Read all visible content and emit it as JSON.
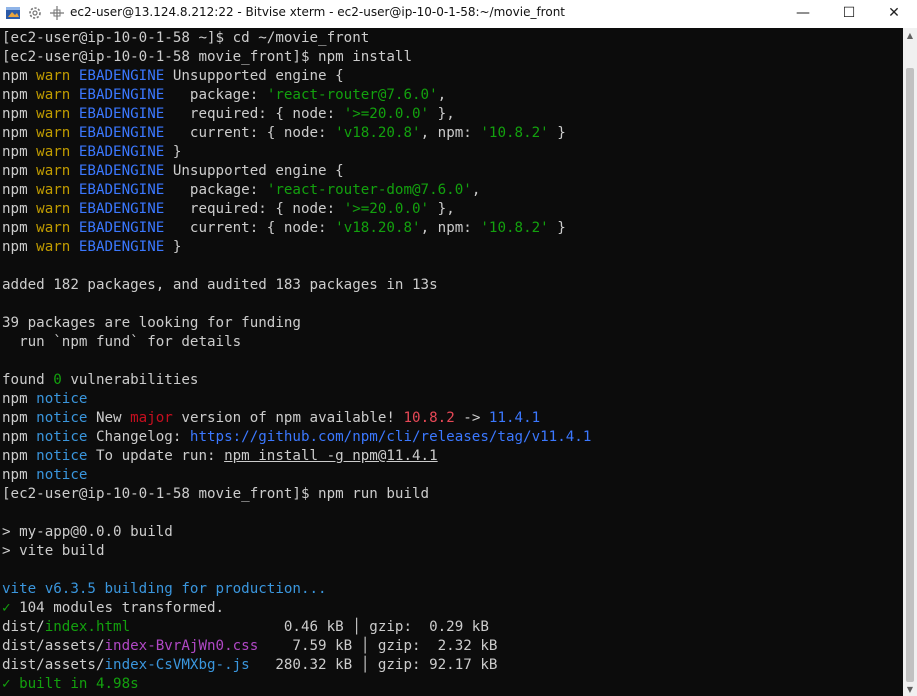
{
  "window": {
    "title": "ec2-user@13.124.8.212:22 - Bitvise xterm - ec2-user@ip-10-0-1-58:~/movie_front",
    "minimize_glyph": "—",
    "maximize_glyph": "☐",
    "close_glyph": "✕"
  },
  "terminal": {
    "lines": [
      [
        {
          "t": "[ec2-user@ip-10-0-1-58 ~]$ cd ~/movie_front",
          "c": "white"
        }
      ],
      [
        {
          "t": "[ec2-user@ip-10-0-1-58 movie_front]$ npm install",
          "c": "white"
        }
      ],
      [
        {
          "t": "npm ",
          "c": "white"
        },
        {
          "t": "warn",
          "c": "yellow"
        },
        {
          "t": " ",
          "c": "white"
        },
        {
          "t": "EBADENGINE",
          "c": "blue"
        },
        {
          "t": " Unsupported engine {",
          "c": "white"
        }
      ],
      [
        {
          "t": "npm ",
          "c": "white"
        },
        {
          "t": "warn",
          "c": "yellow"
        },
        {
          "t": " ",
          "c": "white"
        },
        {
          "t": "EBADENGINE",
          "c": "blue"
        },
        {
          "t": "   package: ",
          "c": "white"
        },
        {
          "t": "'react-router@7.6.0'",
          "c": "green"
        },
        {
          "t": ",",
          "c": "white"
        }
      ],
      [
        {
          "t": "npm ",
          "c": "white"
        },
        {
          "t": "warn",
          "c": "yellow"
        },
        {
          "t": " ",
          "c": "white"
        },
        {
          "t": "EBADENGINE",
          "c": "blue"
        },
        {
          "t": "   required: { node: ",
          "c": "white"
        },
        {
          "t": "'>=20.0.0'",
          "c": "green"
        },
        {
          "t": " },",
          "c": "white"
        }
      ],
      [
        {
          "t": "npm ",
          "c": "white"
        },
        {
          "t": "warn",
          "c": "yellow"
        },
        {
          "t": " ",
          "c": "white"
        },
        {
          "t": "EBADENGINE",
          "c": "blue"
        },
        {
          "t": "   current: { node: ",
          "c": "white"
        },
        {
          "t": "'v18.20.8'",
          "c": "green"
        },
        {
          "t": ", npm: ",
          "c": "white"
        },
        {
          "t": "'10.8.2'",
          "c": "green"
        },
        {
          "t": " }",
          "c": "white"
        }
      ],
      [
        {
          "t": "npm ",
          "c": "white"
        },
        {
          "t": "warn",
          "c": "yellow"
        },
        {
          "t": " ",
          "c": "white"
        },
        {
          "t": "EBADENGINE",
          "c": "blue"
        },
        {
          "t": " }",
          "c": "white"
        }
      ],
      [
        {
          "t": "npm ",
          "c": "white"
        },
        {
          "t": "warn",
          "c": "yellow"
        },
        {
          "t": " ",
          "c": "white"
        },
        {
          "t": "EBADENGINE",
          "c": "blue"
        },
        {
          "t": " Unsupported engine {",
          "c": "white"
        }
      ],
      [
        {
          "t": "npm ",
          "c": "white"
        },
        {
          "t": "warn",
          "c": "yellow"
        },
        {
          "t": " ",
          "c": "white"
        },
        {
          "t": "EBADENGINE",
          "c": "blue"
        },
        {
          "t": "   package: ",
          "c": "white"
        },
        {
          "t": "'react-router-dom@7.6.0'",
          "c": "green"
        },
        {
          "t": ",",
          "c": "white"
        }
      ],
      [
        {
          "t": "npm ",
          "c": "white"
        },
        {
          "t": "warn",
          "c": "yellow"
        },
        {
          "t": " ",
          "c": "white"
        },
        {
          "t": "EBADENGINE",
          "c": "blue"
        },
        {
          "t": "   required: { node: ",
          "c": "white"
        },
        {
          "t": "'>=20.0.0'",
          "c": "green"
        },
        {
          "t": " },",
          "c": "white"
        }
      ],
      [
        {
          "t": "npm ",
          "c": "white"
        },
        {
          "t": "warn",
          "c": "yellow"
        },
        {
          "t": " ",
          "c": "white"
        },
        {
          "t": "EBADENGINE",
          "c": "blue"
        },
        {
          "t": "   current: { node: ",
          "c": "white"
        },
        {
          "t": "'v18.20.8'",
          "c": "green"
        },
        {
          "t": ", npm: ",
          "c": "white"
        },
        {
          "t": "'10.8.2'",
          "c": "green"
        },
        {
          "t": " }",
          "c": "white"
        }
      ],
      [
        {
          "t": "npm ",
          "c": "white"
        },
        {
          "t": "warn",
          "c": "yellow"
        },
        {
          "t": " ",
          "c": "white"
        },
        {
          "t": "EBADENGINE",
          "c": "blue"
        },
        {
          "t": " }",
          "c": "white"
        }
      ],
      [],
      [
        {
          "t": "added 182 packages, and audited 183 packages in 13s",
          "c": "white"
        }
      ],
      [],
      [
        {
          "t": "39 packages are looking for funding",
          "c": "white"
        }
      ],
      [
        {
          "t": "  run `npm fund` for details",
          "c": "white"
        }
      ],
      [],
      [
        {
          "t": "found ",
          "c": "white"
        },
        {
          "t": "0",
          "c": "green"
        },
        {
          "t": " vulnerabilities",
          "c": "white"
        }
      ],
      [
        {
          "t": "npm ",
          "c": "white"
        },
        {
          "t": "notice",
          "c": "cyan"
        }
      ],
      [
        {
          "t": "npm ",
          "c": "white"
        },
        {
          "t": "notice",
          "c": "cyan"
        },
        {
          "t": " New ",
          "c": "white"
        },
        {
          "t": "major",
          "c": "darkred"
        },
        {
          "t": " version of npm available! ",
          "c": "white"
        },
        {
          "t": "10.8.2",
          "c": "red"
        },
        {
          "t": " -> ",
          "c": "white"
        },
        {
          "t": "11.4.1",
          "c": "blue"
        }
      ],
      [
        {
          "t": "npm ",
          "c": "white"
        },
        {
          "t": "notice",
          "c": "cyan"
        },
        {
          "t": " Changelog: ",
          "c": "white"
        },
        {
          "t": "https://github.com/npm/cli/releases/tag/v11.4.1",
          "c": "blue"
        }
      ],
      [
        {
          "t": "npm ",
          "c": "white"
        },
        {
          "t": "notice",
          "c": "cyan"
        },
        {
          "t": " To update run: ",
          "c": "white"
        },
        {
          "t": "npm install -g npm@11.4.1",
          "c": "white",
          "u": true
        }
      ],
      [
        {
          "t": "npm ",
          "c": "white"
        },
        {
          "t": "notice",
          "c": "cyan"
        }
      ],
      [
        {
          "t": "[ec2-user@ip-10-0-1-58 movie_front]$ npm run build",
          "c": "white"
        }
      ],
      [],
      [
        {
          "t": "> my-app@0.0.0 build",
          "c": "white"
        }
      ],
      [
        {
          "t": "> vite build",
          "c": "white"
        }
      ],
      [],
      [
        {
          "t": "vite v6.3.5 building for production...",
          "c": "cyan"
        }
      ],
      [
        {
          "t": "✓",
          "c": "green"
        },
        {
          "t": " 104 modules transformed.",
          "c": "white"
        }
      ],
      [
        {
          "t": "dist/",
          "c": "white"
        },
        {
          "t": "index.html",
          "c": "green"
        },
        {
          "t": "                  0.46 kB │ gzip:  0.29 kB",
          "c": "white"
        }
      ],
      [
        {
          "t": "dist/assets/",
          "c": "white"
        },
        {
          "t": "index-BvrAjWn0.css",
          "c": "magenta"
        },
        {
          "t": "    7.59 kB │ gzip:  2.32 kB",
          "c": "white"
        }
      ],
      [
        {
          "t": "dist/assets/",
          "c": "white"
        },
        {
          "t": "index-CsVMXbg-.js",
          "c": "cyan"
        },
        {
          "t": "   280.32 kB │ gzip: 92.17 kB",
          "c": "white"
        }
      ],
      [
        {
          "t": "✓ built in 4.98s",
          "c": "green"
        }
      ]
    ]
  }
}
